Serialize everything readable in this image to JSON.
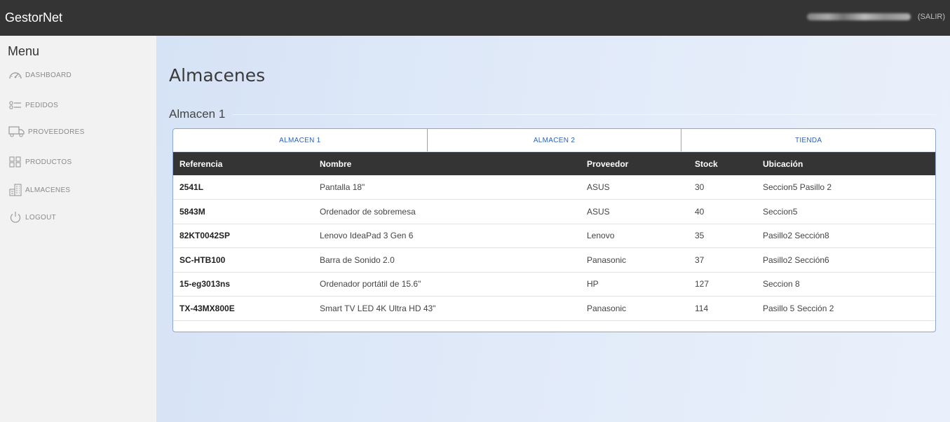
{
  "app": {
    "title": "GestorNet"
  },
  "user": {
    "logout_label": "(SALIR)"
  },
  "sidebar": {
    "menu_title": "Menu",
    "items": [
      {
        "label": "DASHBOARD",
        "icon": "dashboard-icon"
      },
      {
        "label": "PEDIDOS",
        "icon": "checklist-icon"
      },
      {
        "label": "PROVEEDORES",
        "icon": "truck-icon"
      },
      {
        "label": "PRODUCTOS",
        "icon": "grid-icon"
      },
      {
        "label": "ALMACENES",
        "icon": "building-icon"
      },
      {
        "label": "LOGOUT",
        "icon": "power-icon"
      }
    ]
  },
  "main": {
    "page_title": "Almacenes",
    "section_title": "Almacen 1",
    "tabs": [
      {
        "label": "ALMACEN 1"
      },
      {
        "label": "ALMACEN 2"
      },
      {
        "label": "TIENDA"
      }
    ],
    "table": {
      "headers": [
        "Referencia",
        "Nombre",
        "Proveedor",
        "Stock",
        "Ubicación"
      ],
      "rows": [
        [
          "2541L",
          "Pantalla 18\"",
          "ASUS",
          "30",
          "Seccion5 Pasillo 2"
        ],
        [
          "5843M",
          "Ordenador de sobremesa",
          "ASUS",
          "40",
          "Seccion5"
        ],
        [
          "82KT0042SP",
          "Lenovo IdeaPad 3 Gen 6",
          "Lenovo",
          "35",
          "Pasillo2 Sección8"
        ],
        [
          "SC-HTB100",
          "Barra de Sonido 2.0",
          "Panasonic",
          "37",
          "Pasillo2 Sección6"
        ],
        [
          "15-eg3013ns",
          "Ordenador portátil de 15.6\"",
          "HP",
          "127",
          "Seccion 8"
        ],
        [
          "TX-43MX800E",
          "Smart TV LED 4K Ultra HD 43\"",
          "Panasonic",
          "114",
          "Pasillo 5 Sección 2"
        ]
      ]
    }
  }
}
